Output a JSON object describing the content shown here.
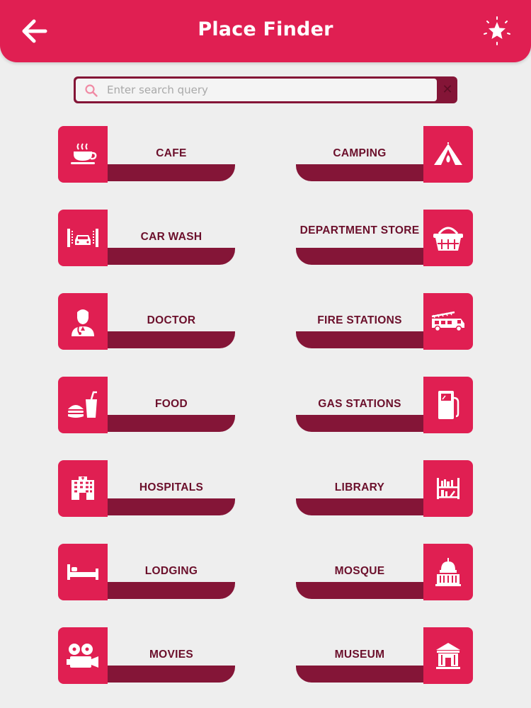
{
  "header": {
    "title": "Place Finder",
    "back_icon": "back-arrow-icon",
    "rate_icon": "star-sparkle-icon",
    "bg_color": "#e01f52"
  },
  "search": {
    "placeholder": "Enter search query",
    "value": "",
    "search_icon": "magnifier-icon",
    "clear_icon": "close-icon"
  },
  "colors": {
    "accent": "#e01f52",
    "dark": "#841537",
    "label_text": "#6b0f2b",
    "background": "#eeeeee"
  },
  "categories": [
    {
      "label": "CAFE",
      "icon": "coffee-cup-icon"
    },
    {
      "label": "CAMPING",
      "icon": "tent-icon"
    },
    {
      "label": "CAR WASH",
      "icon": "car-wash-icon"
    },
    {
      "label": "DEPARTMENT STORE",
      "icon": "basket-icon"
    },
    {
      "label": "DOCTOR",
      "icon": "doctor-icon"
    },
    {
      "label": "FIRE STATIONS",
      "icon": "fire-truck-icon"
    },
    {
      "label": "FOOD",
      "icon": "burger-drink-icon"
    },
    {
      "label": "GAS STATIONS",
      "icon": "fuel-pump-icon"
    },
    {
      "label": "HOSPITALS",
      "icon": "hospital-building-icon"
    },
    {
      "label": "LIBRARY",
      "icon": "bookshelf-icon"
    },
    {
      "label": "LODGING",
      "icon": "bed-icon"
    },
    {
      "label": "MOSQUE",
      "icon": "dome-icon"
    },
    {
      "label": "MOVIES",
      "icon": "film-camera-icon"
    },
    {
      "label": "MUSEUM",
      "icon": "museum-icon"
    }
  ]
}
